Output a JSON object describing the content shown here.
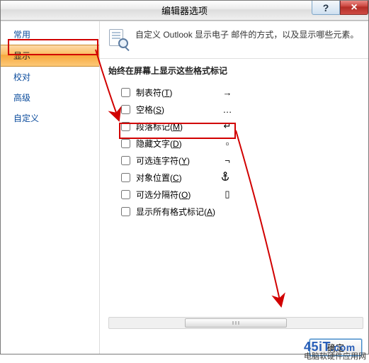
{
  "window": {
    "title": "编辑器选项",
    "help": "?",
    "close": "×"
  },
  "sidebar": {
    "items": [
      {
        "label": "常用"
      },
      {
        "label": "显示"
      },
      {
        "label": "校对"
      },
      {
        "label": "高级"
      },
      {
        "label": "自定义"
      }
    ],
    "selected_index": 1
  },
  "description": "自定义 Outlook 显示电子 邮件的方式，以及显示哪些元素。",
  "section_title": "始终在屏幕上显示这些格式标记",
  "options": [
    {
      "label_pre": "制表符(",
      "key": "T",
      "label_post": ")",
      "symbol": "→"
    },
    {
      "label_pre": "空格(",
      "key": "S",
      "label_post": ")",
      "symbol": "…"
    },
    {
      "label_pre": "段落标记(",
      "key": "M",
      "label_post": ")",
      "symbol": "↵"
    },
    {
      "label_pre": "隐藏文字(",
      "key": "D",
      "label_post": ")",
      "symbol": "▫"
    },
    {
      "label_pre": "可选连字符(",
      "key": "Y",
      "label_post": ")",
      "symbol": "¬"
    },
    {
      "label_pre": "对象位置(",
      "key": "C",
      "label_post": ")",
      "symbol": "anchor"
    },
    {
      "label_pre": "可选分隔符(",
      "key": "O",
      "label_post": ")",
      "symbol": "▯"
    },
    {
      "label_pre": "显示所有格式标记(",
      "key": "A",
      "label_post": ")",
      "symbol": ""
    }
  ],
  "footer": {
    "ok": "确定"
  },
  "watermark": {
    "brand1": "45iT",
    "brand2": ".com",
    "tagline": "电脑软硬件应用网"
  }
}
